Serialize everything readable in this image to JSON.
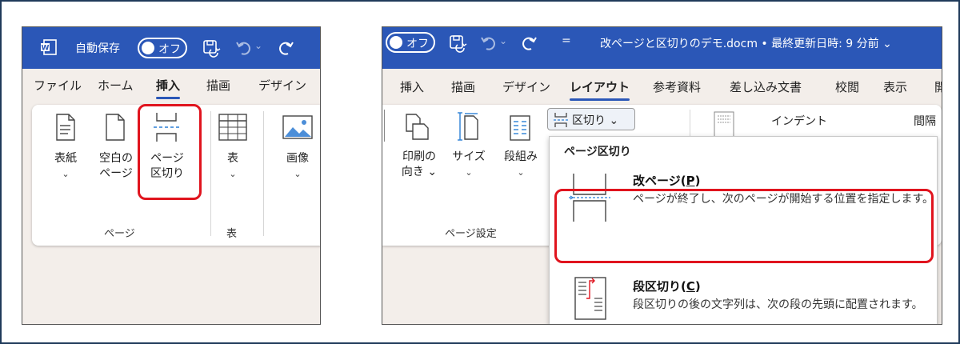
{
  "left": {
    "titlebar": {
      "app_icon": "word-icon",
      "autosave_label": "自動保存",
      "autosave_state": "オフ",
      "icons": [
        "save-icon",
        "undo-icon",
        "redo-icon"
      ]
    },
    "tabs": [
      "ファイル",
      "ホーム",
      "挿入",
      "描画",
      "デザイン"
    ],
    "active_tab": "挿入",
    "buttons": {
      "cover": {
        "line1": "表紙",
        "chev": "⌄"
      },
      "blank_page": {
        "line1": "空白の",
        "line2": "ページ"
      },
      "page_break": {
        "line1": "ページ",
        "line2": "区切り"
      },
      "table": {
        "line1": "表",
        "chev": "⌄"
      },
      "picture": {
        "line1": "画像",
        "chev": "⌄"
      }
    },
    "groups": {
      "pages": "ページ",
      "tables": "表"
    }
  },
  "right": {
    "titlebar": {
      "autosave_state": "オフ",
      "doc_title": "改ページと区切りのデモ.docm • 最終更新日時: 9 分前 ⌄",
      "icons": [
        "save-icon",
        "undo-icon",
        "redo-icon",
        "customize-icon"
      ]
    },
    "tabs": [
      "挿入",
      "描画",
      "デザイン",
      "レイアウト",
      "参考資料",
      "差し込み文書",
      "校閲",
      "表示",
      "開"
    ],
    "active_tab": "レイアウト",
    "buttons": {
      "orientation": {
        "line1": "印刷の",
        "line2": "向き ⌄"
      },
      "size": {
        "line1": "サイズ",
        "chev": "⌄"
      },
      "columns": {
        "line1": "段組み",
        "chev": "⌄"
      },
      "breaks": "区切り ⌄",
      "indent": "インデント",
      "spacing": "間隔"
    },
    "groups": {
      "page_setup": "ページ設定"
    },
    "dropdown": {
      "heading": "ページ区切り",
      "items": [
        {
          "title": "改ページ(",
          "key": "P",
          "close": ")",
          "desc": "ページが終了し、次のページが開始する位置を指定します。"
        },
        {
          "title": "段区切り(",
          "key": "C",
          "close": ")",
          "desc": "段区切りの後の文字列は、次の段の先頭に配置されます。"
        }
      ]
    }
  },
  "colors": {
    "accent": "#2b57b7",
    "highlight": "#e0141e",
    "ribbon_bg": "#f3eeea"
  }
}
